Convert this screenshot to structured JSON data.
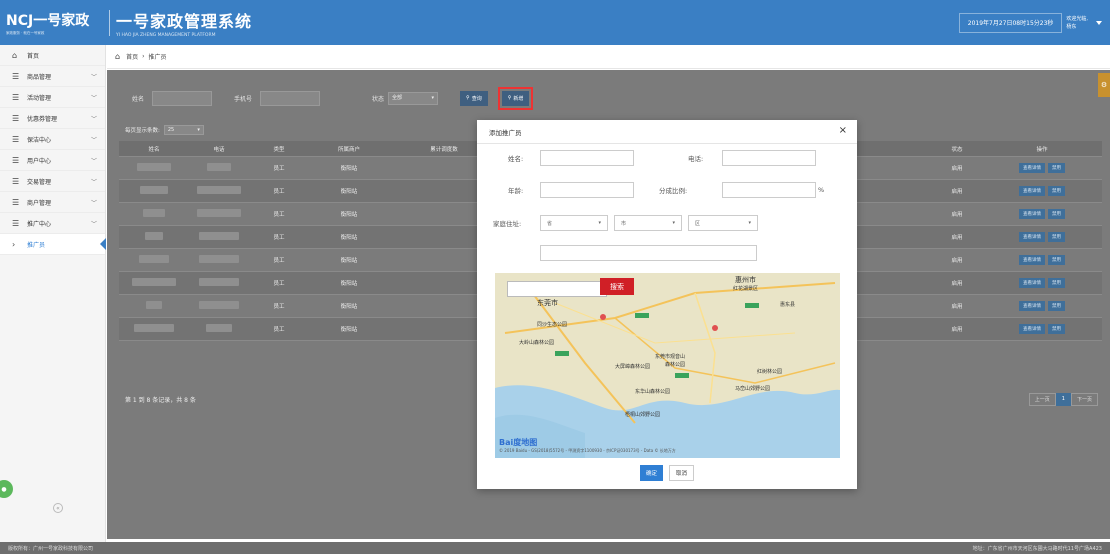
{
  "header": {
    "logo_text": "NCJ一号家政",
    "logo_sub": "家政服务 · 就在一号家政",
    "system_title": "一号家政管理系统",
    "system_sub": "YI HAO JIA ZHENG MANAGEMENT PLATFORM",
    "datetime": "2019年7月27日08时15分23秒",
    "welcome_line1": "欢迎光临,",
    "welcome_line2": "杨东"
  },
  "sidebar": {
    "items": [
      {
        "label": "首页",
        "icon": "home-icon",
        "chevron": false
      },
      {
        "label": "商品管理",
        "icon": "list-icon",
        "chevron": true
      },
      {
        "label": "活动管理",
        "icon": "list-icon",
        "chevron": true
      },
      {
        "label": "优惠券管理",
        "icon": "list-icon",
        "chevron": true
      },
      {
        "label": "保洁中心",
        "icon": "list-icon",
        "chevron": true
      },
      {
        "label": "用户中心",
        "icon": "list-icon",
        "chevron": true
      },
      {
        "label": "交易管理",
        "icon": "list-icon",
        "chevron": true
      },
      {
        "label": "商户管理",
        "icon": "list-icon",
        "chevron": true
      },
      {
        "label": "推广中心",
        "icon": "list-icon",
        "chevron": true
      },
      {
        "label": "推广员",
        "icon": "bullet-icon",
        "chevron": false,
        "active": true
      }
    ],
    "collapse_glyph": "«"
  },
  "breadcrumb": {
    "home": "首页",
    "sep": "›",
    "current": "推广员"
  },
  "filter": {
    "name_label": "姓名",
    "phone_label": "手机号",
    "status_label": "状态",
    "status_value": "全部",
    "query_label": "查询",
    "add_label": "新增"
  },
  "pagesize": {
    "label": "每页显示条数:",
    "value": "25"
  },
  "table": {
    "headers": [
      "姓名",
      "电话",
      "类型",
      "所属商户",
      "累计调度数",
      "",
      "状态",
      "操作"
    ],
    "rows": [
      {
        "type": "员工",
        "merchant": "衡阳站",
        "status": "启用"
      },
      {
        "type": "员工",
        "merchant": "衡阳站",
        "status": "启用"
      },
      {
        "type": "员工",
        "merchant": "衡阳站",
        "status": "启用"
      },
      {
        "type": "员工",
        "merchant": "衡阳站",
        "status": "启用"
      },
      {
        "type": "员工",
        "merchant": "衡阳站",
        "status": "启用"
      },
      {
        "type": "员工",
        "merchant": "衡阳站",
        "status": "启用"
      },
      {
        "type": "员工",
        "merchant": "衡阳站",
        "status": "启用"
      },
      {
        "type": "员工",
        "merchant": "衡阳站",
        "status": "启用"
      }
    ],
    "op_detail": "查看详情",
    "op_disable": "禁用",
    "summary": "第 1 到 8 条记录，共 8 条",
    "pager": {
      "prev": "上一页",
      "current": "1",
      "next": "下一页"
    }
  },
  "modal": {
    "title": "添加推广员",
    "close_glyph": "×",
    "name_label": "姓名:",
    "phone_label": "电话:",
    "age_label": "年龄:",
    "ratio_label": "分成比例:",
    "ratio_unit": "%",
    "address_label": "家庭住址:",
    "province": "省",
    "city": "市",
    "district": "区",
    "map": {
      "search_btn": "搜索",
      "labels": [
        "惠州市",
        "东莞市",
        "红花湖景区",
        "同沙生态公园",
        "大岭山森林公园",
        "东莞市观音山",
        "森林公园",
        "大屏嶂森林公园",
        "东华山森林公园",
        "马峦山郊野公园",
        "梧桐山郊野公园",
        "惠东县",
        "红树林公园"
      ],
      "copyright": "© 2019 Baidu - GS(2018)5572号 - 甲测资字1100930 - 京ICP证030173号 - Data © 长地万方",
      "brand": "Bai度地图"
    },
    "ok_label": "确定",
    "cancel_label": "取消"
  },
  "footer": {
    "left": "版权所有：广州一号家政科技有限公司",
    "right": "地址：广东省广州市天河区东圃大马路时代11号广场A423"
  }
}
